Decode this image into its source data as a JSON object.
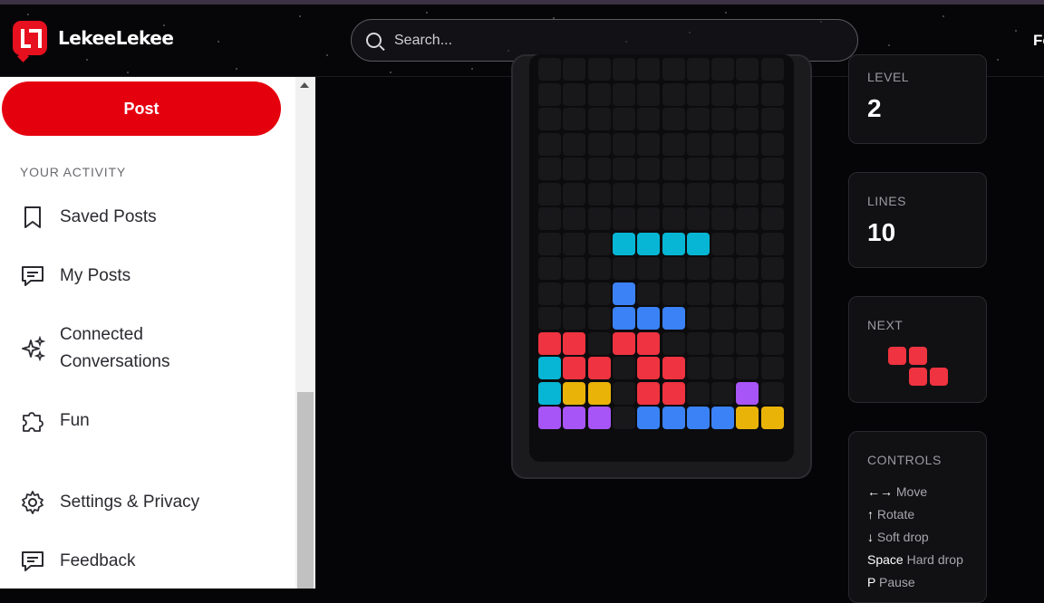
{
  "header": {
    "brand": "LekeeLekee",
    "search_placeholder": "Search...",
    "nav_partial": "Fo"
  },
  "sidebar": {
    "post_label": "Post",
    "section_label": "YOUR ACTIVITY",
    "items": [
      {
        "label": "Saved Posts",
        "icon": "bookmark-icon"
      },
      {
        "label": "My Posts",
        "icon": "message-icon"
      },
      {
        "label": "Connected Conversations",
        "icon": "sparkle-icon"
      },
      {
        "label": "Fun",
        "icon": "puzzle-icon"
      },
      {
        "label": "Settings & Privacy",
        "icon": "gear-icon"
      },
      {
        "label": "Feedback",
        "icon": "feedback-icon"
      }
    ]
  },
  "game": {
    "level_label": "LEVEL",
    "level": "2",
    "lines_label": "LINES",
    "lines": "10",
    "next_label": "NEXT",
    "next_piece": "Z",
    "controls_label": "CONTROLS",
    "controls": [
      {
        "key": "←→",
        "action": "Move"
      },
      {
        "key": "↑",
        "action": "Rotate"
      },
      {
        "key": "↓",
        "action": "Soft drop"
      },
      {
        "key": "Space",
        "action": "Hard drop"
      },
      {
        "key": "P",
        "action": "Pause"
      }
    ],
    "colors": {
      "empty": "#18181b",
      "cyan": "#06b6d4",
      "blue": "#3b82f6",
      "red": "#ef3340",
      "yellow": "#eab308",
      "purple": "#a855f7"
    },
    "board_rows": [
      "..........",
      "..........",
      "..........",
      "..........",
      "..........",
      "..........",
      "..........",
      "...CCCC...",
      "..........",
      "...B......",
      "...BBB....",
      "RR.RR.....",
      "CRR.RR....",
      "CYY.RR..P.",
      "PPP.BBBBYY"
    ]
  }
}
